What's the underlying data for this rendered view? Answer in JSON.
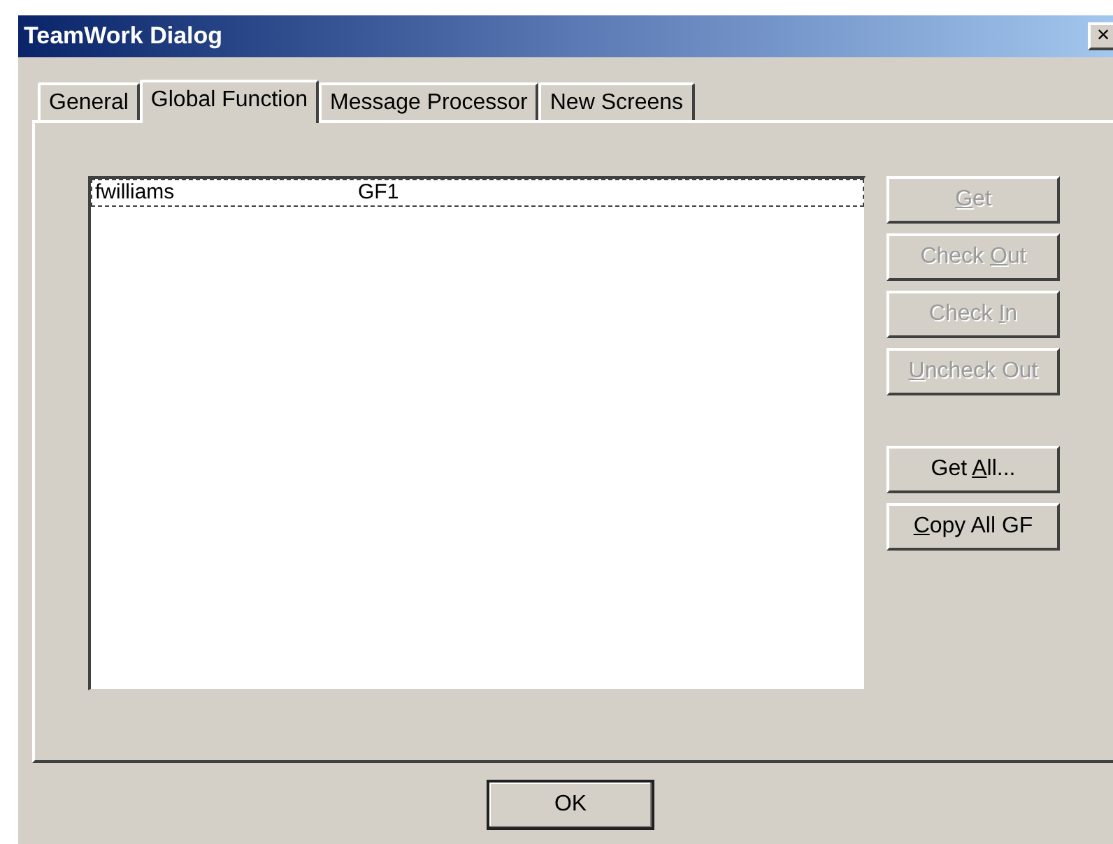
{
  "window": {
    "title": "TeamWork Dialog",
    "close": "×"
  },
  "tabs": [
    {
      "label": "General",
      "selected": false
    },
    {
      "label": "Global Function",
      "selected": true
    },
    {
      "label": "Message Processor",
      "selected": false
    },
    {
      "label": "New Screens",
      "selected": false
    }
  ],
  "list": {
    "rows": [
      {
        "cells": [
          "fwilliams",
          "GF1"
        ],
        "selected": true
      }
    ]
  },
  "buttons": [
    {
      "label": [
        {
          "text": "G",
          "underline": true
        },
        {
          "text": "et",
          "underline": false
        }
      ],
      "disabled": true
    },
    {
      "label": [
        {
          "text": "Check ",
          "underline": false
        },
        {
          "text": "O",
          "underline": true
        },
        {
          "text": "ut",
          "underline": false
        }
      ],
      "disabled": true
    },
    {
      "label": [
        {
          "text": "Check ",
          "underline": false
        },
        {
          "text": "I",
          "underline": true
        },
        {
          "text": "n",
          "underline": false
        }
      ],
      "disabled": true
    },
    {
      "label": [
        {
          "text": "U",
          "underline": true
        },
        {
          "text": "ncheck Out",
          "underline": false
        }
      ],
      "disabled": true
    },
    {
      "label": [
        {
          "text": "Get ",
          "underline": false
        },
        {
          "text": "A",
          "underline": true
        },
        {
          "text": "ll...",
          "underline": false
        }
      ],
      "disabled": false
    },
    {
      "label": [
        {
          "text": "C",
          "underline": true
        },
        {
          "text": "opy All GF",
          "underline": false
        }
      ],
      "disabled": false
    }
  ],
  "ok_button": {
    "label": "OK"
  }
}
